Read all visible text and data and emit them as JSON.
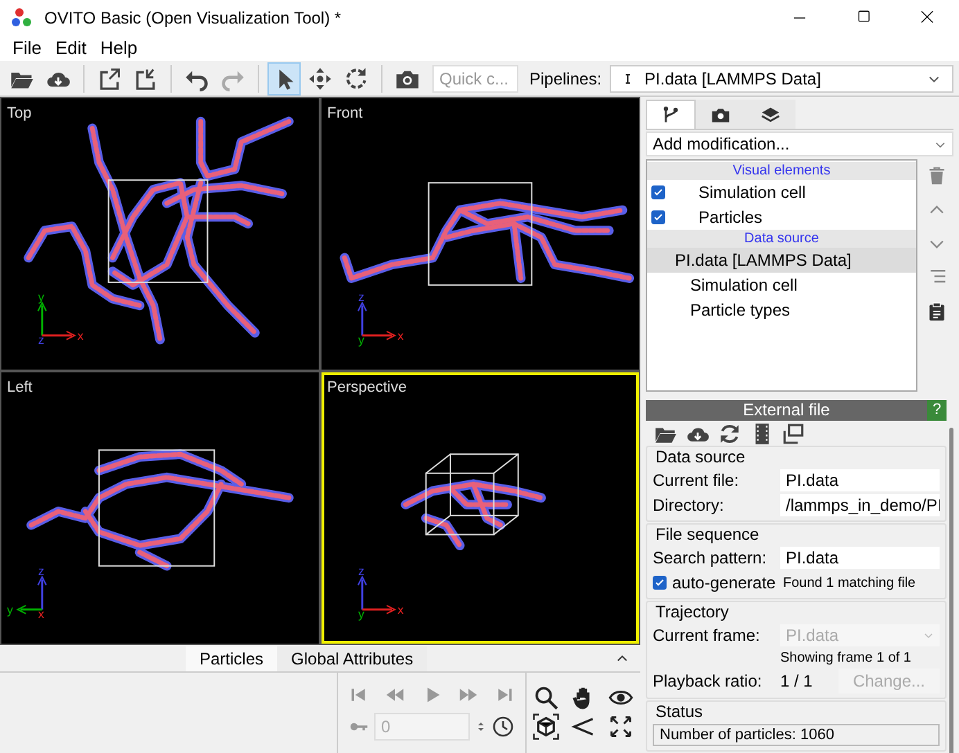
{
  "window": {
    "title": "OVITO Basic (Open Visualization Tool) *"
  },
  "menu": [
    "File",
    "Edit",
    "Help"
  ],
  "toolbar": {
    "modes": [
      {
        "selected": true
      },
      {
        "selected": false
      },
      {
        "selected": false
      }
    ],
    "quick_command": {
      "placeholder": "Quick c..."
    },
    "pipelines_label": "Pipelines:",
    "pipeline": "PI.data [LAMMPS Data]"
  },
  "viewports": [
    {
      "title": "Top",
      "selected": false,
      "axes": [
        {
          "kind": "up",
          "label": "y",
          "color": "#00b000"
        },
        {
          "kind": "origin",
          "label": "z",
          "color": "#4040e0"
        },
        {
          "kind": "right",
          "label": "x",
          "color": "#e02020"
        }
      ]
    },
    {
      "title": "Front",
      "selected": false,
      "axes": [
        {
          "kind": "up",
          "label": "z",
          "color": "#4040e0"
        },
        {
          "kind": "origin",
          "label": "y",
          "color": "#00b000"
        },
        {
          "kind": "right",
          "label": "x",
          "color": "#e02020"
        }
      ]
    },
    {
      "title": "Left",
      "selected": false,
      "axes": [
        {
          "kind": "up",
          "label": "z",
          "color": "#4040e0"
        },
        {
          "kind": "left",
          "label": "y",
          "color": "#00b000"
        },
        {
          "kind": "origin",
          "label": "x",
          "color": "#e02020"
        }
      ]
    },
    {
      "title": "Perspective",
      "selected": true,
      "axes": [
        {
          "kind": "up",
          "label": "z",
          "color": "#4040e0"
        },
        {
          "kind": "origin",
          "label": "y",
          "color": "#00b000"
        },
        {
          "kind": "right",
          "label": "x",
          "color": "#e02020"
        }
      ]
    }
  ],
  "data_tabs": [
    {
      "label": "Particles",
      "selected": true
    },
    {
      "label": "Global Attributes",
      "selected": false
    }
  ],
  "animation": {
    "frame": "0"
  },
  "panel_tabs": [
    {
      "selected": true
    },
    {
      "selected": false
    },
    {
      "selected": false
    }
  ],
  "add_modification": "Add modification...",
  "pipeline_items": [
    {
      "kind": "header",
      "label": "Visual elements"
    },
    {
      "kind": "visual",
      "label": "Simulation cell",
      "checked": true,
      "selected": false
    },
    {
      "kind": "visual",
      "label": "Particles",
      "checked": true,
      "selected": false
    },
    {
      "kind": "header",
      "label": "Data source"
    },
    {
      "kind": "source",
      "label": "PI.data [LAMMPS Data]",
      "selected": true
    },
    {
      "kind": "sub",
      "label": "Simulation cell",
      "selected": false
    },
    {
      "kind": "sub",
      "label": "Particle types",
      "selected": false
    }
  ],
  "rollout": {
    "title": "External file",
    "help": "?",
    "sections": [
      {
        "title": "Data source",
        "rows": [
          {
            "kind": "field",
            "label": "Current file:",
            "value": "PI.data"
          },
          {
            "kind": "field",
            "label": "Directory:",
            "value": "/lammps_in_demo/PI"
          }
        ]
      },
      {
        "title": "File sequence",
        "rows": [
          {
            "kind": "field",
            "label": "Search pattern:",
            "value": "PI.data"
          },
          {
            "kind": "check",
            "label": "auto-generate",
            "checked": true,
            "note": "Found 1 matching file"
          }
        ]
      },
      {
        "title": "Trajectory",
        "rows": [
          {
            "kind": "combo",
            "label": "Current frame:",
            "value": "PI.data",
            "disabled": true
          },
          {
            "kind": "note",
            "text": "Showing frame 1 of 1"
          },
          {
            "kind": "button",
            "label": "Playback ratio:",
            "value": "1 / 1",
            "button": "Change...",
            "disabled": true
          }
        ]
      },
      {
        "title": "Status",
        "rows": [
          {
            "kind": "status",
            "text": "Number of particles: 1060"
          }
        ]
      }
    ]
  }
}
